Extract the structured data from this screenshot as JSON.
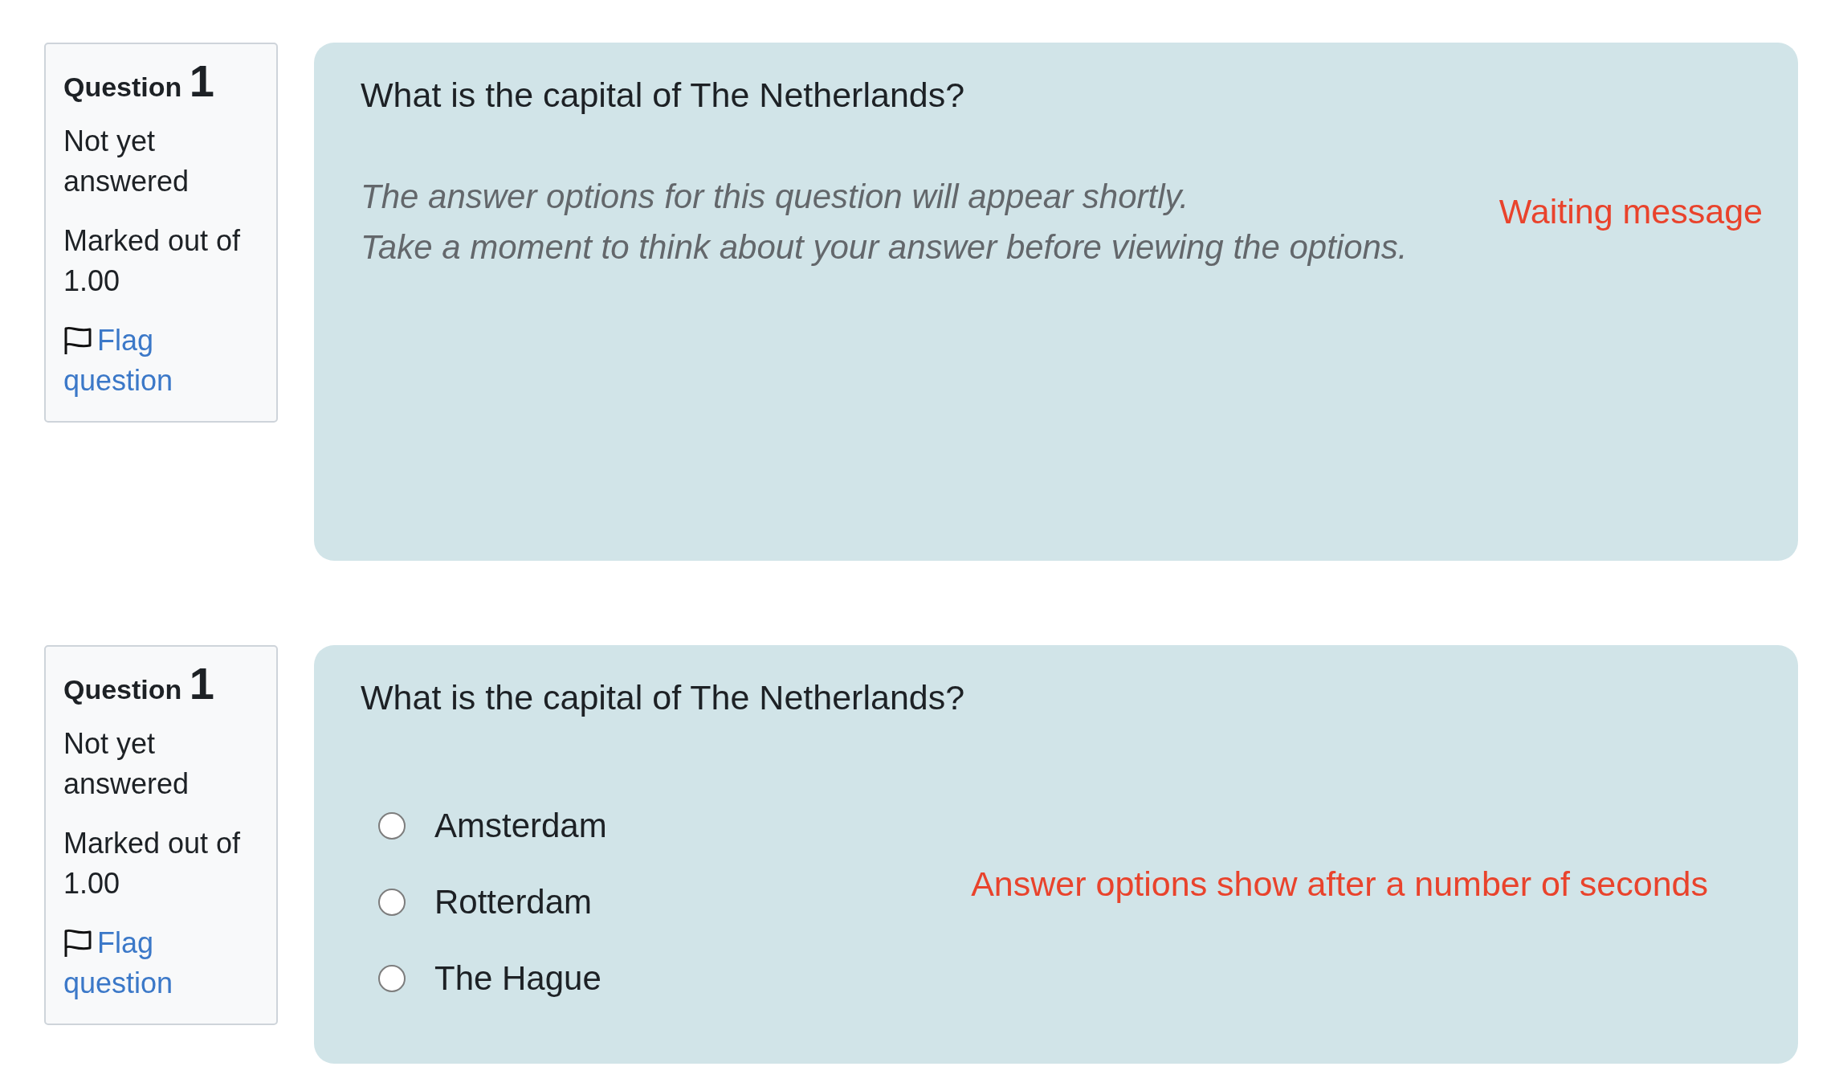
{
  "questions": [
    {
      "kind": "waiting",
      "info": {
        "label": "Question",
        "number": "1",
        "state": "Not yet answered",
        "grade": "Marked out of 1.00",
        "flag": {
          "text": "Flag question",
          "flagged": false
        }
      },
      "question_text": "What is the capital of The Netherlands?",
      "waiting_lines": [
        "The answer options for this question will appear shortly.",
        "Take a moment to think about your answer before viewing the options."
      ],
      "annotation": "Waiting message"
    },
    {
      "kind": "options",
      "info": {
        "label": "Question",
        "number": "1",
        "state": "Not yet answered",
        "grade": "Marked out of 1.00",
        "flag": {
          "text": "Flag question",
          "flagged": false
        }
      },
      "question_text": "What is the capital of The Netherlands?",
      "options": [
        {
          "label": "Amsterdam",
          "selected": false
        },
        {
          "label": "Rotterdam",
          "selected": false
        },
        {
          "label": "The Hague",
          "selected": false
        }
      ],
      "annotation": "Answer options show after a number of seconds"
    }
  ]
}
